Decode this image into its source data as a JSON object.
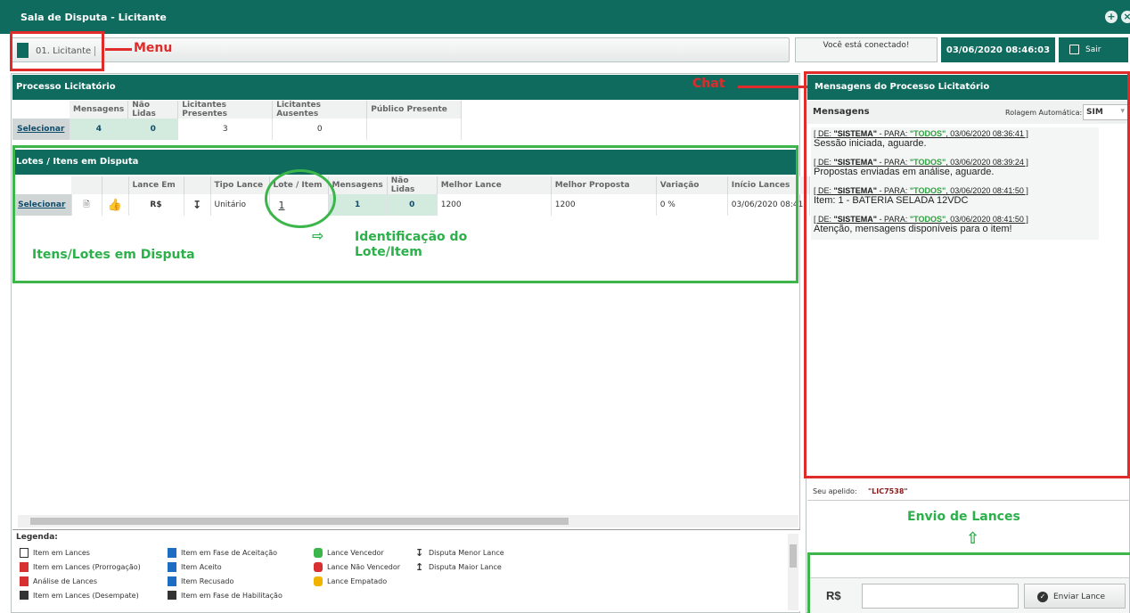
{
  "window_title": "Sala de Disputa - Licitante",
  "menu": {
    "tab_label": "01. Licitante"
  },
  "status": {
    "connected": "Você está conectado!",
    "datetime": "03/06/2020 08:46:03",
    "exit_label": "Sair"
  },
  "annotations": {
    "menu": "Menu",
    "chat": "Chat",
    "items": "Itens/Lotes em Disputa",
    "ident": "Identificação do\nLote/Item",
    "envio": "Envio de Lances"
  },
  "processo": {
    "title": "Processo Licitatório",
    "headers": [
      "Mensagens",
      "Não Lidas",
      "Licitantes Presentes",
      "Licitantes Ausentes",
      "Público Presente"
    ],
    "select_label": "Selecionar",
    "row": [
      "4",
      "0",
      "3",
      "0",
      ""
    ]
  },
  "lotes": {
    "title": "Lotes / Itens em Disputa",
    "headers": [
      "Lance Em",
      "Tipo Lance",
      "Lote / Item",
      "Mensagens",
      "Não Lidas",
      "Melhor Lance",
      "Melhor Proposta",
      "Variação",
      "Início Lances"
    ],
    "select_label": "Selecionar",
    "row": {
      "lance_em": "R$",
      "tipo": "Unitário",
      "lote": "1",
      "mensagens": "1",
      "nao_lidas": "0",
      "melhor_lance": "1200",
      "melhor_proposta": "1200",
      "variacao": "0 %",
      "inicio": "03/06/2020 08:41:"
    }
  },
  "legenda": {
    "title": "Legenda:",
    "items": [
      "Item em Lances",
      "Item em Lances (Prorrogação)",
      "Análise de Lances",
      "Item em Lances (Desempate)",
      "Item em Fase de Aceitação",
      "Item Aceito",
      "Item Recusado",
      "Item em Fase de Habilitação",
      "Lance Vencedor",
      "Lance Não Vencedor",
      "Lance Empatado",
      "Disputa Menor Lance",
      "Disputa Maior Lance"
    ]
  },
  "chat": {
    "title": "Mensagens do Processo Licitatório",
    "mensagens_label": "Mensagens",
    "rolagem_label": "Rolagem Automática:",
    "rolagem_value": "SIM",
    "messages": [
      {
        "de": "[ DE: ",
        "from": "\"SISTEMA\"",
        "para": " - PARA: ",
        "to": "\"TODOS\"",
        "ts": ", 03/06/2020 08:36:41 ]",
        "text": "Sessão iniciada, aguarde."
      },
      {
        "de": "[ DE: ",
        "from": "\"SISTEMA\"",
        "para": " - PARA: ",
        "to": "\"TODOS\"",
        "ts": ", 03/06/2020 08:39:24 ]",
        "text": "Propostas enviadas em análise, aguarde."
      },
      {
        "de": "[ DE: ",
        "from": "\"SISTEMA\"",
        "para": " - PARA: ",
        "to": "\"TODOS\"",
        "ts": ", 03/06/2020 08:41:50 ]",
        "text": "Item: 1 - BATERIA SELADA 12VDC"
      },
      {
        "de": "[ DE: ",
        "from": "\"SISTEMA\"",
        "para": " - PARA: ",
        "to": "\"TODOS\"",
        "ts": ", 03/06/2020 08:41:50 ]",
        "text": "Atenção, mensagens disponíveis para o item!"
      }
    ]
  },
  "lance": {
    "apelido_label": "Seu apelido:",
    "apelido_value": "\"LIC7538\"",
    "currency": "R$",
    "send_label": "Enviar Lance"
  },
  "colors": {
    "teal": "#0e6b5e",
    "annotation_red": "#e02b2b",
    "annotation_green": "#3cb54a"
  }
}
